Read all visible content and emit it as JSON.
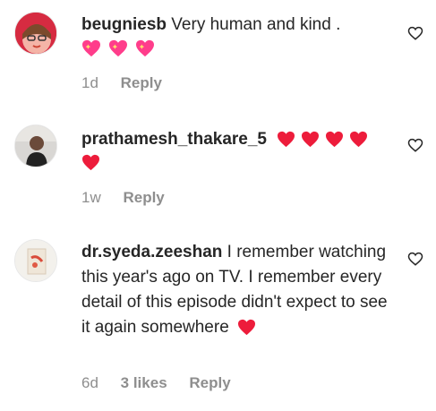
{
  "comments": [
    {
      "username": "beugniesb",
      "text": "Very human and kind .",
      "time": "1d",
      "reply_label": "Reply",
      "emoji": [
        "sparkling-heart",
        "sparkling-heart",
        "sparkling-heart"
      ]
    },
    {
      "username": "prathamesh_thakare_5",
      "text": "",
      "time": "1w",
      "reply_label": "Reply",
      "emoji": [
        "red-heart",
        "red-heart",
        "red-heart",
        "red-heart",
        "red-heart"
      ]
    },
    {
      "username": "dr.syeda.zeeshan",
      "text": "I remember watching this year's ago on TV. I remember every detail of this episode didn't expect to see it again somewhere",
      "time": "6d",
      "likes": "3 likes",
      "reply_label": "Reply",
      "emoji": [
        "red-heart"
      ]
    }
  ],
  "colors": {
    "text": "#262626",
    "meta": "#8e8e8e",
    "heart": "#ed1c3b",
    "sparkle_heart": "#ff3d8b"
  },
  "icons": {
    "like": "heart-outline-icon"
  }
}
